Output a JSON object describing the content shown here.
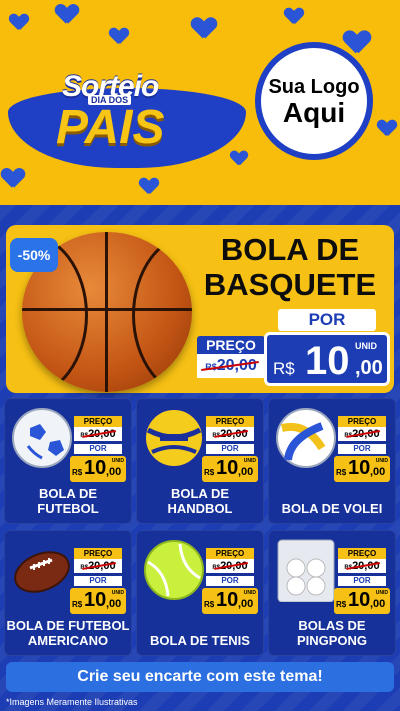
{
  "header": {
    "title_word1": "Sorteio",
    "title_word2": "DIA DOS",
    "title_word3": "PAIS",
    "brand_line1": "Sua Logo",
    "brand_line2": "Aqui"
  },
  "featured": {
    "discount": "-50%",
    "name_line1": "BOLA DE",
    "name_line2": "BASQUETE",
    "por_label": "POR",
    "preco_label": "PREÇO",
    "old_currency": "R$",
    "old_price": "20,00",
    "currency": "R$",
    "unid_label": "UNID",
    "price_int": "10",
    "price_dec": ",00"
  },
  "product_labels": {
    "preco": "PREÇO",
    "old_currency": "R$",
    "old_price": "20,00",
    "por": "POR",
    "currency": "R$",
    "price_int": "10",
    "price_dec": ",00",
    "unid": "UNID"
  },
  "products": [
    {
      "line1": "BOLA DE",
      "line2": "FUTEBOL",
      "icon": "soccer-ball-icon"
    },
    {
      "line1": "BOLA DE",
      "line2": "HANDBOL",
      "icon": "handball-icon"
    },
    {
      "line1": "BOLA DE VOLEI",
      "line2": "",
      "icon": "volleyball-icon"
    },
    {
      "line1": "BOLA DE FUTEBOL",
      "line2": "AMERICANO",
      "icon": "american-football-icon"
    },
    {
      "line1": "BOLA DE TENIS",
      "line2": "",
      "icon": "tennis-ball-icon"
    },
    {
      "line1": "BOLAS DE",
      "line2": "PINGPONG",
      "icon": "pingpong-balls-icon"
    }
  ],
  "cta": "Crie seu encarte com este tema!",
  "disclaimer": "*Imagens Meramente Ilustrativas",
  "colors": {
    "yellow": "#f6c014",
    "blue": "#1c3db3",
    "cta": "#2b6fe0"
  }
}
